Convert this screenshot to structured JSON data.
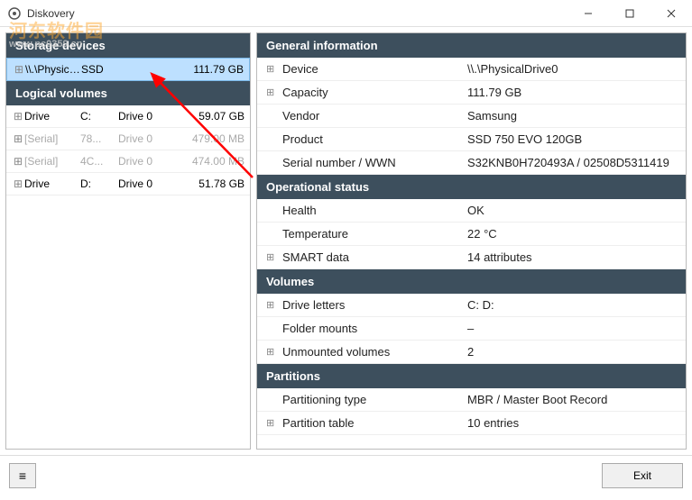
{
  "window": {
    "title": "Diskovery"
  },
  "watermark": {
    "text": "河东软件园",
    "url": "www.pc0359.cn"
  },
  "left": {
    "storage_header": "Storage devices",
    "storage_device": {
      "name": "\\\\.\\Physical...",
      "type": "SSD",
      "size": "111.79 GB"
    },
    "volumes_header": "Logical volumes",
    "volumes": [
      {
        "kind": "Drive",
        "letter": "C:",
        "drive": "Drive 0",
        "size": "59.07 GB",
        "gray": false
      },
      {
        "kind": "[Serial]",
        "letter": "78...",
        "drive": "Drive 0",
        "size": "479.00 MB",
        "gray": true
      },
      {
        "kind": "[Serial]",
        "letter": "4C...",
        "drive": "Drive 0",
        "size": "474.00 MB",
        "gray": true
      },
      {
        "kind": "Drive",
        "letter": "D:",
        "drive": "Drive 0",
        "size": "51.78 GB",
        "gray": false
      }
    ]
  },
  "right": {
    "sections": [
      {
        "title": "General information",
        "rows": [
          {
            "expand": true,
            "key": "Device",
            "val": "\\\\.\\PhysicalDrive0"
          },
          {
            "expand": true,
            "key": "Capacity",
            "val": "111.79 GB"
          },
          {
            "expand": false,
            "key": "Vendor",
            "val": "Samsung"
          },
          {
            "expand": false,
            "key": "Product",
            "val": "SSD 750 EVO 120GB"
          },
          {
            "expand": false,
            "key": "Serial number / WWN",
            "val": "S32KNB0H720493A / 02508D5311419"
          }
        ]
      },
      {
        "title": "Operational status",
        "rows": [
          {
            "expand": false,
            "key": "Health",
            "val": "OK"
          },
          {
            "expand": false,
            "key": "Temperature",
            "val": "22 °C"
          },
          {
            "expand": true,
            "key": "SMART data",
            "val": "14 attributes"
          }
        ]
      },
      {
        "title": "Volumes",
        "rows": [
          {
            "expand": true,
            "key": "Drive letters",
            "val": "C:  D:"
          },
          {
            "expand": false,
            "key": "Folder mounts",
            "val": "–"
          },
          {
            "expand": true,
            "key": "Unmounted volumes",
            "val": "2"
          }
        ]
      },
      {
        "title": "Partitions",
        "rows": [
          {
            "expand": false,
            "key": "Partitioning type",
            "val": "MBR / Master Boot Record"
          },
          {
            "expand": true,
            "key": "Partition table",
            "val": "10 entries"
          }
        ]
      }
    ]
  },
  "bottom": {
    "exit": "Exit"
  }
}
